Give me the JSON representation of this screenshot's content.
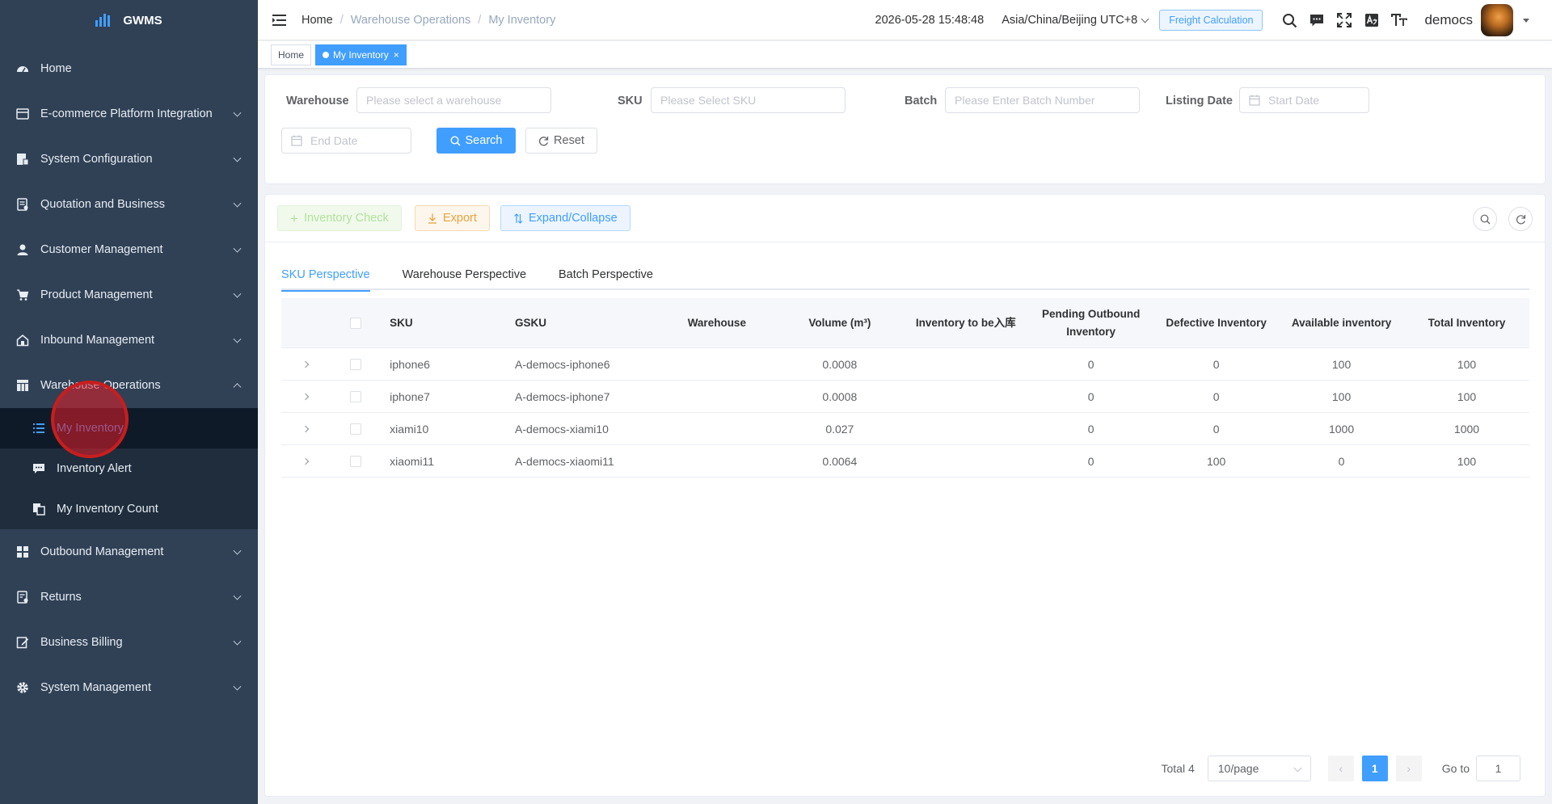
{
  "app": {
    "name": "GWMS"
  },
  "sidebar": {
    "items": [
      {
        "label": "Home",
        "icon": "dashboard-icon"
      },
      {
        "label": "E-commerce Platform Integration",
        "icon": "store-icon"
      },
      {
        "label": "System Configuration",
        "icon": "config-icon"
      },
      {
        "label": "Quotation and Business",
        "icon": "quotation-icon"
      },
      {
        "label": "Customer Management",
        "icon": "user-icon"
      },
      {
        "label": "Product Management",
        "icon": "cart-icon"
      },
      {
        "label": "Inbound Management",
        "icon": "home-icon"
      },
      {
        "label": "Warehouse Operations",
        "icon": "table-icon"
      },
      {
        "label": "Outbound Management",
        "icon": "grid-icon"
      },
      {
        "label": "Returns",
        "icon": "returns-icon"
      },
      {
        "label": "Business Billing",
        "icon": "edit-icon"
      },
      {
        "label": "System Management",
        "icon": "gear-icon"
      }
    ],
    "warehouse_submenu": [
      {
        "label": "My Inventory",
        "icon": "list-icon"
      },
      {
        "label": "Inventory Alert",
        "icon": "chat-icon"
      },
      {
        "label": "My Inventory Count",
        "icon": "copy-icon"
      }
    ]
  },
  "header": {
    "breadcrumb": [
      "Home",
      "Warehouse Operations",
      "My Inventory"
    ],
    "datetime": "2026-05-28 15:48:48",
    "timezone": "Asia/China/Beijing UTC+8",
    "freight_button": "Freight Calculation",
    "username": "democs"
  },
  "tags": {
    "home": "Home",
    "current": "My Inventory",
    "close": "×"
  },
  "filters": {
    "warehouse_label": "Warehouse",
    "warehouse_placeholder": "Please select a warehouse",
    "sku_label": "SKU",
    "sku_placeholder": "Please Select SKU",
    "batch_label": "Batch",
    "batch_placeholder": "Please Enter Batch Number",
    "listing_date_label": "Listing Date",
    "start_date_placeholder": "Start Date",
    "end_date_placeholder": "End Date",
    "search_label": "Search",
    "reset_label": "Reset"
  },
  "toolbar": {
    "inventory_check": "Inventory Check",
    "export": "Export",
    "expand_collapse": "Expand/Collapse"
  },
  "tabs": [
    "SKU Perspective",
    "Warehouse Perspective",
    "Batch Perspective"
  ],
  "table": {
    "headers": {
      "sku": "SKU",
      "gsku": "GSKU",
      "warehouse": "Warehouse",
      "volume": "Volume (m³)",
      "to_be_inbound": "Inventory to be入库",
      "pending_outbound": "Pending Outbound Inventory",
      "defective": "Defective Inventory",
      "available": "Available inventory",
      "total": "Total Inventory"
    },
    "rows": [
      {
        "sku": "iphone6",
        "gsku": "A-democs-iphone6",
        "warehouse": "",
        "volume": "0.0008",
        "to_be_inbound": "",
        "pending_outbound": "0",
        "defective": "0",
        "available": "100",
        "total": "100"
      },
      {
        "sku": "iphone7",
        "gsku": "A-democs-iphone7",
        "warehouse": "",
        "volume": "0.0008",
        "to_be_inbound": "",
        "pending_outbound": "0",
        "defective": "0",
        "available": "100",
        "total": "100"
      },
      {
        "sku": "xiami10",
        "gsku": "A-democs-xiami10",
        "warehouse": "",
        "volume": "0.027",
        "to_be_inbound": "",
        "pending_outbound": "0",
        "defective": "0",
        "available": "1000",
        "total": "1000"
      },
      {
        "sku": "xiaomi11",
        "gsku": "A-democs-xiaomi11",
        "warehouse": "",
        "volume": "0.0064",
        "to_be_inbound": "",
        "pending_outbound": "0",
        "defective": "100",
        "available": "0",
        "total": "100"
      }
    ]
  },
  "pagination": {
    "total": "Total 4",
    "page_size": "10/page",
    "prev": "‹",
    "current_page": "1",
    "next": "›",
    "goto_label": "Go to",
    "goto_value": "1"
  },
  "colors": {
    "sidebar_bg": "#304156",
    "submenu_bg": "#1f2d3d",
    "primary": "#409eff",
    "click_marker": "#c81e1e"
  }
}
